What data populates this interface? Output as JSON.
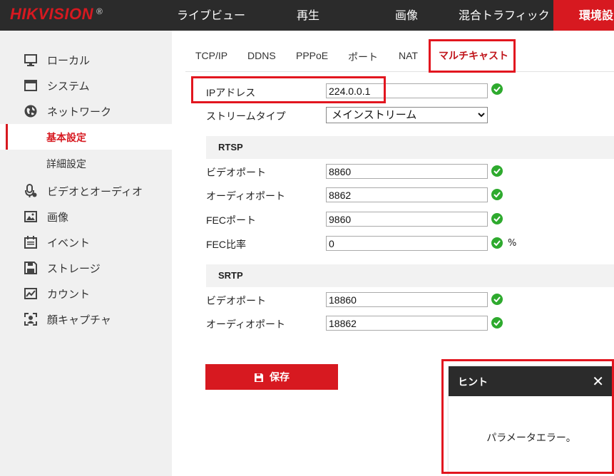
{
  "brand": {
    "logo": "HIKVISION",
    "reg": "®"
  },
  "topnav": [
    {
      "label": "ライブビュー"
    },
    {
      "label": "再生"
    },
    {
      "label": "画像"
    },
    {
      "label": "混合トラフィック"
    },
    {
      "label": "環境設"
    }
  ],
  "sidebar": {
    "items": [
      {
        "label": "ローカル",
        "icon": "monitor-icon"
      },
      {
        "label": "システム",
        "icon": "system-window-icon"
      },
      {
        "label": "ネットワーク",
        "icon": "globe-icon"
      },
      {
        "label": "基本設定",
        "active": true
      },
      {
        "label": "詳細設定"
      },
      {
        "label": "ビデオとオーディオ",
        "icon": "microphone-icon"
      },
      {
        "label": "画像",
        "icon": "image-icon"
      },
      {
        "label": "イベント",
        "icon": "calendar-icon"
      },
      {
        "label": "ストレージ",
        "icon": "floppy-icon"
      },
      {
        "label": "カウント",
        "icon": "chart-icon"
      },
      {
        "label": "顔キャプチャ",
        "icon": "face-capture-icon"
      }
    ]
  },
  "tabs": [
    {
      "label": "TCP/IP"
    },
    {
      "label": "DDNS"
    },
    {
      "label": "PPPoE"
    },
    {
      "label": "ポート"
    },
    {
      "label": "NAT"
    },
    {
      "label": "マルチキャスト",
      "active": true
    }
  ],
  "form": {
    "ip_label": "IPアドレス",
    "ip_value": "224.0.0.1",
    "stream_label": "ストリームタイプ",
    "stream_value": "メインストリーム",
    "rtsp_title": "RTSP",
    "rtsp_video_label": "ビデオポート",
    "rtsp_video_value": "8860",
    "rtsp_audio_label": "オーディオポート",
    "rtsp_audio_value": "8862",
    "fec_port_label": "FECポート",
    "fec_port_value": "9860",
    "fec_ratio_label": "FEC比率",
    "fec_ratio_value": "0",
    "fec_ratio_unit": "%",
    "srtp_title": "SRTP",
    "srtp_video_label": "ビデオポート",
    "srtp_video_value": "18860",
    "srtp_audio_label": "オーディオポート",
    "srtp_audio_value": "18862",
    "save_label": "保存"
  },
  "dialog": {
    "title": "ヒント",
    "close": "✕",
    "message": "パラメータエラー。"
  },
  "colors": {
    "accent": "#d71920",
    "ok": "#2eaa2e",
    "topbar": "#2b2b2b",
    "highlight": "#e2161f"
  }
}
